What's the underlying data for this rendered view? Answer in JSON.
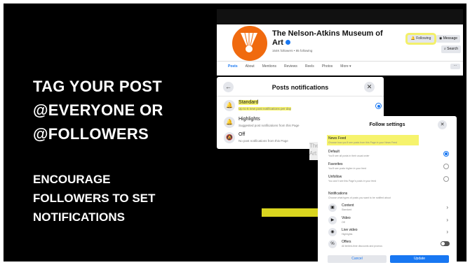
{
  "headline": [
    "TAG YOUR POST",
    "@EVERYONE OR",
    "@FOLLOWERS"
  ],
  "subhead": [
    "ENCOURAGE",
    "FOLLOWERS TO SET",
    "NOTIFICATIONS"
  ],
  "fb_page": {
    "name": "The Nelson-Atkins Museum of Art",
    "meta": "164K followers • 85 following",
    "following_label": "Following",
    "message_label": "Message",
    "search_label": "Search",
    "nav": [
      "Posts",
      "About",
      "Mentions",
      "Reviews",
      "Reels",
      "Photos",
      "More ▾"
    ],
    "more_label": "···"
  },
  "posts_notifications": {
    "title": "Posts notifications",
    "options": [
      {
        "label": "Standard",
        "desc": "Up to 6 new post notifications per day",
        "selected": true
      },
      {
        "label": "Highlights",
        "desc": "Suggested post notifications from this Page",
        "selected": false
      },
      {
        "label": "Off",
        "desc": "No post notifications from this Page",
        "selected": false
      }
    ]
  },
  "follow_settings": {
    "title": "Follow settings",
    "news_feed_title": "News Feed",
    "news_feed_desc": "Choose how you'll see posts from this Page in your News Feed",
    "feed_options": [
      {
        "label": "Default",
        "desc": "You'll see all posts in their usual order",
        "selected": true
      },
      {
        "label": "Favorites",
        "desc": "You'll see posts higher in your feed",
        "selected": false
      },
      {
        "label": "Unfollow",
        "desc": "You won't see this Page's posts in your feed",
        "selected": false
      }
    ],
    "notifications_title": "Notifications",
    "notifications_desc": "Choose what types of posts you want to be notified about",
    "notification_rows": [
      {
        "label": "Content",
        "desc": "Standard"
      },
      {
        "label": "Video",
        "desc": "Off"
      },
      {
        "label": "Live video",
        "desc": "Highlights"
      },
      {
        "label": "Offers",
        "desc": "All limited-time discounts and promos"
      }
    ],
    "cancel_label": "Cancel",
    "update_label": "Update"
  },
  "colors": {
    "accent": "#1877f2",
    "highlight": "#f6f36c",
    "brand_orange": "#f06a0f"
  }
}
